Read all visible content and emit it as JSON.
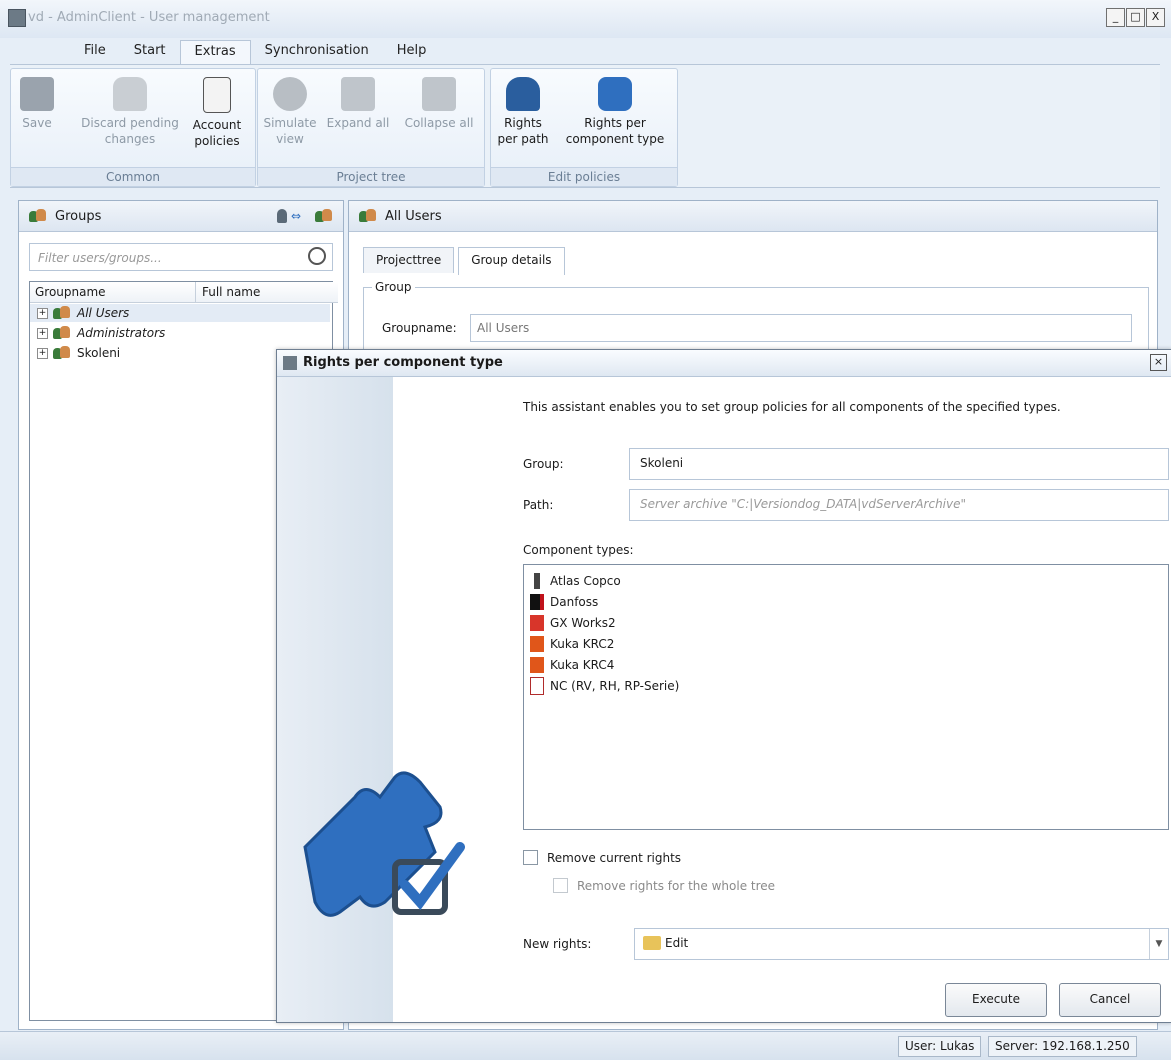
{
  "window": {
    "title": "vd - AdminClient - User management",
    "buttons": [
      "_",
      "□",
      "X"
    ]
  },
  "menu": {
    "tabs": [
      "File",
      "Start",
      "Extras",
      "Synchronisation",
      "Help"
    ],
    "active": "Extras"
  },
  "ribbon": {
    "groups": [
      {
        "label": "Common",
        "buttons": [
          {
            "label": "Save",
            "icon": "floppy-disk-icon",
            "enabled": false
          },
          {
            "label": "Discard pending changes",
            "line1": "Discard pending",
            "line2": "changes",
            "icon": "trash-can-icon",
            "enabled": false
          },
          {
            "label": "Account policies",
            "line1": "Account",
            "line2": "policies",
            "icon": "clipboard-policy-icon",
            "enabled": true
          }
        ]
      },
      {
        "label": "Project tree",
        "buttons": [
          {
            "label": "Simulate view",
            "line1": "Simulate",
            "line2": "view",
            "icon": "eye-icon",
            "enabled": false
          },
          {
            "label": "Expand all",
            "icon": "expand-tree-icon",
            "enabled": false
          },
          {
            "label": "Collapse all",
            "icon": "collapse-tree-icon",
            "enabled": false
          }
        ]
      },
      {
        "label": "Edit policies",
        "buttons": [
          {
            "label": "Rights per path",
            "line1": "Rights",
            "line2": "per path",
            "icon": "user-check-icon",
            "enabled": true
          },
          {
            "label": "Rights per component type",
            "line1": "Rights per",
            "line2": "component type",
            "icon": "puzzle-check-icon",
            "enabled": true
          }
        ]
      }
    ]
  },
  "left_panel": {
    "title": "Groups",
    "filter_placeholder": "Filter users/groups...",
    "columns": [
      "Groupname",
      "Full name"
    ],
    "items": [
      {
        "name": "All Users",
        "italic": true
      },
      {
        "name": "Administrators",
        "italic": true
      },
      {
        "name": "Skoleni",
        "italic": false
      }
    ]
  },
  "right_panel": {
    "title": "All Users",
    "tabs": [
      "Projecttree",
      "Group details"
    ],
    "active_tab": "Group details",
    "group_legend": "Group",
    "groupname_label": "Groupname:",
    "groupname_value": "All Users"
  },
  "dialog": {
    "title": "Rights per component type",
    "intro": "This assistant enables you to set group policies for all components of the specified types.",
    "group_label": "Group:",
    "group_value": "Skoleni",
    "path_label": "Path:",
    "path_value": "Server archive \"C:|Versiondog_DATA|vdServerArchive\"",
    "component_types_label": "Component types:",
    "component_types": [
      {
        "name": "Atlas Copco",
        "color": "#444444"
      },
      {
        "name": "Danfoss",
        "color": "#c0121b"
      },
      {
        "name": "GX Works2",
        "color": "#d8352a"
      },
      {
        "name": "Kuka KRC2",
        "color": "#e0561a"
      },
      {
        "name": "Kuka KRC4",
        "color": "#e0561a"
      },
      {
        "name": "NC (RV, RH, RP-Serie)",
        "color": "#b02b2b"
      }
    ],
    "remove_current_rights": "Remove current rights",
    "remove_whole_tree": "Remove rights for the whole tree",
    "new_rights_label": "New rights:",
    "new_rights_value": "Edit",
    "execute": "Execute",
    "cancel": "Cancel"
  },
  "status": {
    "user": "User: Lukas",
    "server": "Server: 192.168.1.250"
  },
  "colors": {
    "accent": "#2f6fbf",
    "frame": "#9fb2c8",
    "ribbon_bg": "#eaf1f8"
  }
}
